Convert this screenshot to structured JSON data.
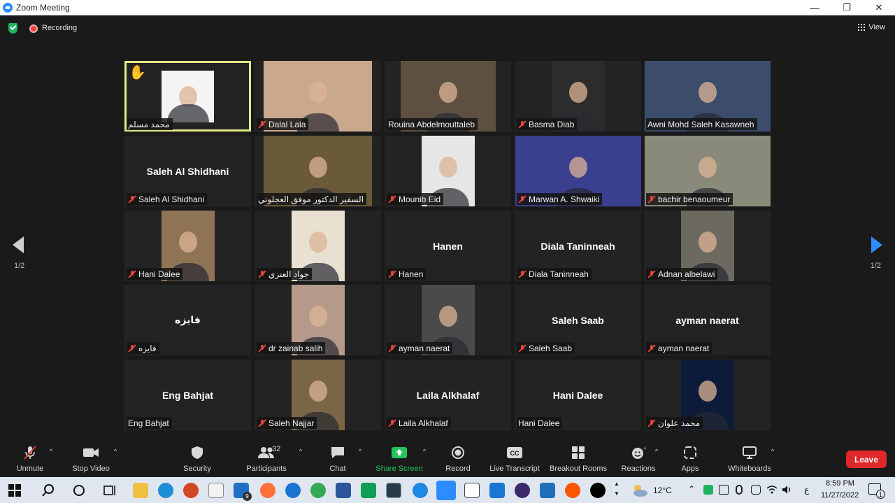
{
  "window": {
    "title": "Zoom Meeting"
  },
  "topbar": {
    "recording": "Recording",
    "view": "View"
  },
  "pager": {
    "left": "1/2",
    "right": "1/2"
  },
  "participants": [
    {
      "name": "محمد مسلم",
      "big": "",
      "muted": false,
      "active": true,
      "hand": true,
      "photo": "#f4f4f4"
    },
    {
      "name": "Dalal Lala",
      "big": "",
      "muted": true,
      "photo": "#c9a88e"
    },
    {
      "name": "Rouina Abdelmouttaleb",
      "big": "",
      "muted": false,
      "photo": "#5d5040"
    },
    {
      "name": "Basma Diab",
      "big": "",
      "muted": true,
      "photo": "#2c2c2c"
    },
    {
      "name": "Awni Mohd Saleh Kasawneh",
      "big": "",
      "muted": false,
      "photo": "#3b4d6b"
    },
    {
      "name": "Saleh Al Shidhani",
      "big": "Saleh Al Shidhani",
      "muted": true,
      "photo": ""
    },
    {
      "name": "السفير الدكتور موفق العجلوني",
      "big": "",
      "muted": false,
      "photo": "#6b5a3a"
    },
    {
      "name": "Mounib Eid",
      "big": "",
      "muted": true,
      "photo": "#e6e6e6"
    },
    {
      "name": "Marwan A. Shwaiki",
      "big": "",
      "muted": true,
      "photo": "#3a3f8f"
    },
    {
      "name": "bachir benaoumeur",
      "big": "",
      "muted": true,
      "photo": "#8a8a7a"
    },
    {
      "name": "Hani Dalee",
      "big": "",
      "muted": true,
      "photo": "#8f7355"
    },
    {
      "name": "جواد العنزي",
      "big": "",
      "muted": true,
      "photo": "#e8e0d0"
    },
    {
      "name": "Hanen",
      "big": "Hanen",
      "muted": true,
      "photo": ""
    },
    {
      "name": "Diala Taninneah",
      "big": "Diala Taninneah",
      "muted": true,
      "photo": ""
    },
    {
      "name": "Adnan albelawi",
      "big": "",
      "muted": true,
      "photo": "#6c6a60"
    },
    {
      "name": "فايزه",
      "big": "فايزه",
      "muted": true,
      "photo": ""
    },
    {
      "name": "dr zainab salih",
      "big": "",
      "muted": true,
      "photo": "#b59a8a"
    },
    {
      "name": "ayman naerat",
      "big": "",
      "muted": true,
      "photo": "#4a4a4a"
    },
    {
      "name": "Saleh Saab",
      "big": "Saleh Saab",
      "muted": true,
      "photo": ""
    },
    {
      "name": "ayman naerat",
      "big": "ayman naerat",
      "muted": true,
      "photo": ""
    },
    {
      "name": "Eng Bahjat",
      "big": "Eng Bahjat",
      "muted": false,
      "photo": ""
    },
    {
      "name": "Saleh Najjar",
      "big": "",
      "muted": true,
      "photo": "#7a6545"
    },
    {
      "name": "Laila Alkhalaf",
      "big": "Laila Alkhalaf",
      "muted": true,
      "photo": ""
    },
    {
      "name": "Hani Dalee",
      "big": "Hani Dalee",
      "muted": false,
      "photo": ""
    },
    {
      "name": "محمد علوان",
      "big": "",
      "muted": true,
      "photo": "#0d1b3a"
    }
  ],
  "toolbar": {
    "unmute": "Unmute",
    "stop_video": "Stop Video",
    "security": "Security",
    "participants": "Participants",
    "participants_count": "32",
    "chat": "Chat",
    "share_screen": "Share Screen",
    "record": "Record",
    "live_transcript": "Live Transcript",
    "breakout_rooms": "Breakout Rooms",
    "reactions": "Reactions",
    "apps": "Apps",
    "whiteboards": "Whiteboards",
    "leave": "Leave"
  },
  "taskbar": {
    "weather": "12°C",
    "time": "8:59 PM",
    "date": "11/27/2022",
    "lang": "ع",
    "notifications": "1",
    "mail_badge": "9"
  }
}
